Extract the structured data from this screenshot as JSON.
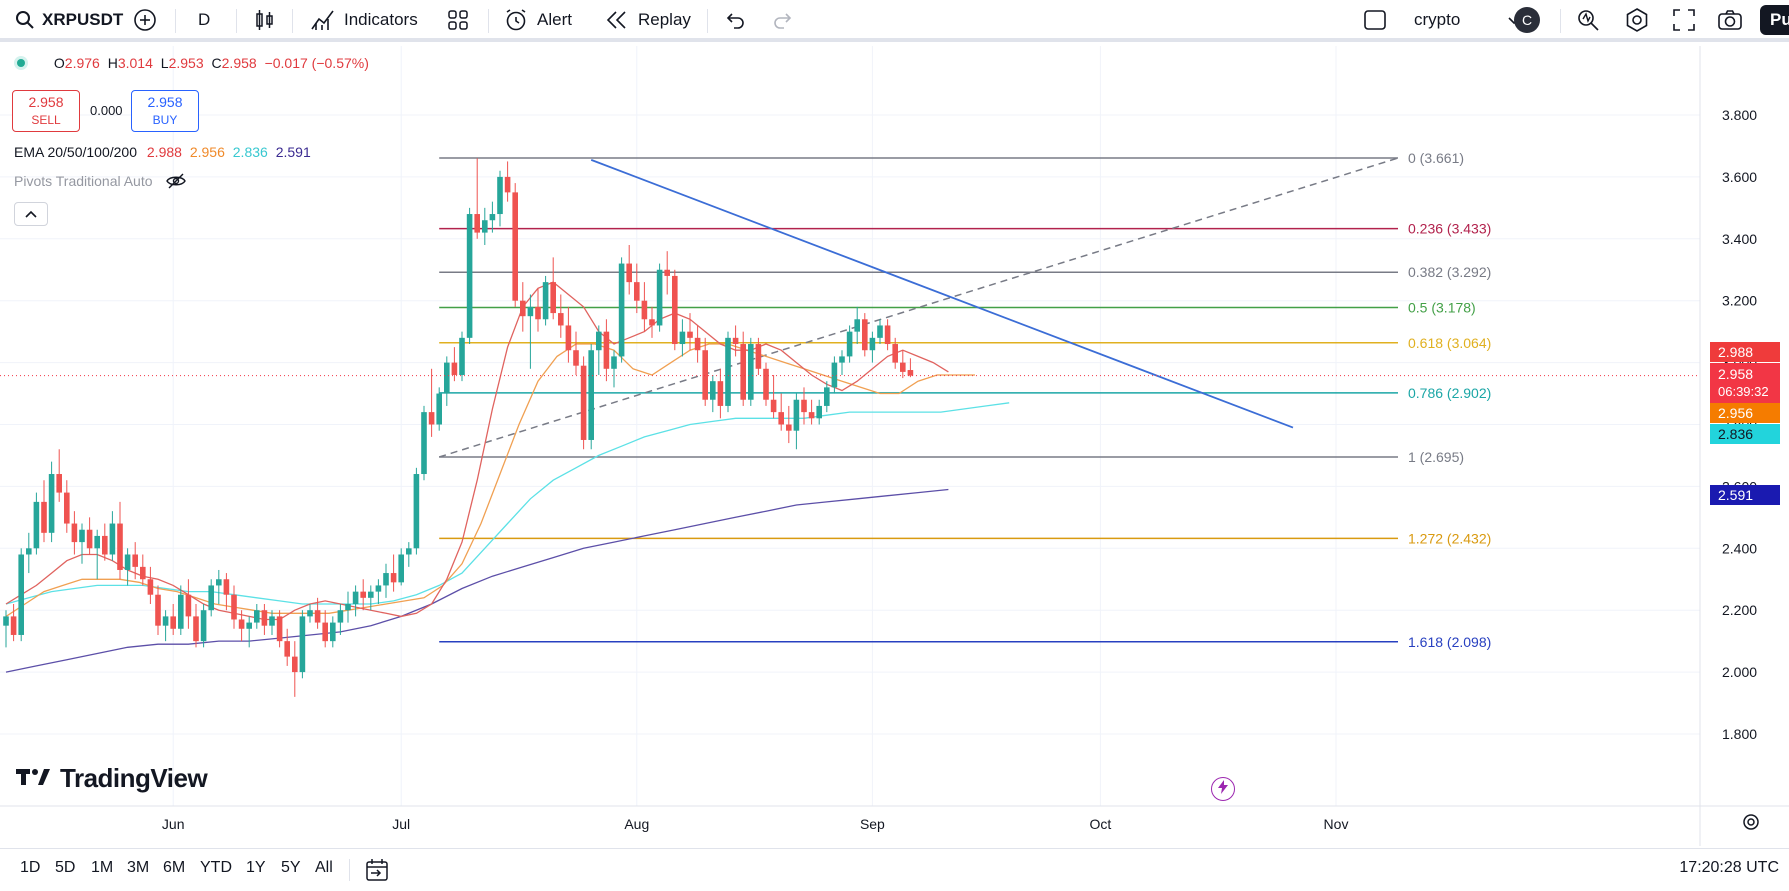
{
  "toolbar": {
    "symbol": "XRPUSDT",
    "interval": "D",
    "indicators_label": "Indicators",
    "alert_label": "Alert",
    "replay_label": "Replay",
    "layout_name": "crypto",
    "avatar_letter": "C",
    "publish_label": "Pu"
  },
  "legend": {
    "o_label": "O",
    "o_value": "2.976",
    "h_label": "H",
    "h_value": "3.014",
    "l_label": "L",
    "l_value": "2.953",
    "c_label": "C",
    "c_value": "2.958",
    "change": "−0.017 (−0.57%)",
    "sell_price": "2.958",
    "sell_label": "SELL",
    "spread": "0.000",
    "buy_price": "2.958",
    "buy_label": "BUY",
    "ema_name": "EMA 20/50/100/200",
    "ema20": "2.988",
    "ema50": "2.956",
    "ema100": "2.836",
    "ema200": "2.591",
    "pivots_label": "Pivots Traditional Auto"
  },
  "colors": {
    "up": "#26a69a",
    "down": "#ef5350",
    "ema20": "#e0635f",
    "ema50": "#f0a052",
    "ema100": "#5ce1e6",
    "ema200": "#5c4fa8",
    "trendline": "#3b6dd6"
  },
  "price_axis": {
    "ticks": [
      "3.800",
      "3.600",
      "3.400",
      "3.200",
      "3.000",
      "2.800",
      "2.600",
      "2.400",
      "2.200",
      "2.000",
      "1.800"
    ],
    "values": [
      3.8,
      3.6,
      3.4,
      3.2,
      3.0,
      2.8,
      2.6,
      2.4,
      2.2,
      2.0,
      1.8
    ]
  },
  "time_axis": {
    "labels": [
      "Jun",
      "Jul",
      "Aug",
      "Sep",
      "Oct",
      "Nov"
    ],
    "day_index": [
      22,
      52,
      83,
      114,
      144,
      175
    ]
  },
  "price_labels": {
    "ema20": "2.988",
    "last": "2.958",
    "countdown": "06:39:32",
    "ema50": "2.956",
    "ema100": "2.836",
    "ema200": "2.591"
  },
  "fibonacci": {
    "levels": [
      {
        "label": "0 (3.661)",
        "price": 3.661,
        "color": "#787b86"
      },
      {
        "label": "0.236 (3.433)",
        "price": 3.433,
        "color": "#b2224d"
      },
      {
        "label": "0.382 (3.292)",
        "price": 3.292,
        "color": "#787b86"
      },
      {
        "label": "0.5 (3.178)",
        "price": 3.178,
        "color": "#43a047"
      },
      {
        "label": "0.618 (3.064)",
        "price": 3.064,
        "color": "#e0b020"
      },
      {
        "label": "0.786 (2.902)",
        "price": 2.902,
        "color": "#1ba6a6"
      },
      {
        "label": "1 (2.695)",
        "price": 2.695,
        "color": "#787b86"
      },
      {
        "label": "1.272 (2.432)",
        "price": 2.432,
        "color": "#d99a10"
      },
      {
        "label": "1.618 (2.098)",
        "price": 2.098,
        "color": "#2840c0"
      }
    ]
  },
  "chart_data": {
    "type": "candlestick",
    "symbol": "XRPUSDT",
    "interval": "D",
    "ylim": [
      1.8,
      3.8
    ],
    "candles": [
      [
        2.15,
        2.2,
        2.08,
        2.18
      ],
      [
        2.18,
        2.22,
        2.1,
        2.12
      ],
      [
        2.12,
        2.4,
        2.1,
        2.38
      ],
      [
        2.38,
        2.45,
        2.32,
        2.4
      ],
      [
        2.4,
        2.58,
        2.38,
        2.55
      ],
      [
        2.55,
        2.62,
        2.42,
        2.45
      ],
      [
        2.45,
        2.68,
        2.42,
        2.64
      ],
      [
        2.64,
        2.72,
        2.55,
        2.58
      ],
      [
        2.58,
        2.62,
        2.45,
        2.48
      ],
      [
        2.48,
        2.52,
        2.38,
        2.42
      ],
      [
        2.42,
        2.48,
        2.35,
        2.46
      ],
      [
        2.46,
        2.5,
        2.38,
        2.4
      ],
      [
        2.4,
        2.46,
        2.3,
        2.44
      ],
      [
        2.44,
        2.48,
        2.36,
        2.38
      ],
      [
        2.38,
        2.52,
        2.36,
        2.48
      ],
      [
        2.48,
        2.55,
        2.3,
        2.33
      ],
      [
        2.33,
        2.4,
        2.28,
        2.38
      ],
      [
        2.38,
        2.42,
        2.3,
        2.34
      ],
      [
        2.34,
        2.38,
        2.28,
        2.3
      ],
      [
        2.3,
        2.34,
        2.22,
        2.25
      ],
      [
        2.25,
        2.28,
        2.12,
        2.15
      ],
      [
        2.15,
        2.2,
        2.1,
        2.18
      ],
      [
        2.18,
        2.22,
        2.12,
        2.14
      ],
      [
        2.14,
        2.28,
        2.12,
        2.25
      ],
      [
        2.25,
        2.3,
        2.14,
        2.18
      ],
      [
        2.18,
        2.22,
        2.08,
        2.1
      ],
      [
        2.1,
        2.22,
        2.08,
        2.2
      ],
      [
        2.2,
        2.3,
        2.18,
        2.28
      ],
      [
        2.28,
        2.33,
        2.22,
        2.3
      ],
      [
        2.3,
        2.32,
        2.2,
        2.25
      ],
      [
        2.25,
        2.28,
        2.14,
        2.17
      ],
      [
        2.17,
        2.2,
        2.1,
        2.14
      ],
      [
        2.14,
        2.18,
        2.08,
        2.16
      ],
      [
        2.16,
        2.22,
        2.14,
        2.2
      ],
      [
        2.2,
        2.22,
        2.12,
        2.15
      ],
      [
        2.15,
        2.2,
        2.12,
        2.18
      ],
      [
        2.18,
        2.2,
        2.08,
        2.1
      ],
      [
        2.1,
        2.14,
        2.02,
        2.05
      ],
      [
        2.05,
        2.1,
        1.92,
        2.0
      ],
      [
        2.0,
        2.2,
        1.98,
        2.18
      ],
      [
        2.18,
        2.22,
        2.16,
        2.2
      ],
      [
        2.2,
        2.24,
        2.14,
        2.16
      ],
      [
        2.16,
        2.2,
        2.08,
        2.1
      ],
      [
        2.1,
        2.18,
        2.08,
        2.16
      ],
      [
        2.16,
        2.22,
        2.12,
        2.2
      ],
      [
        2.2,
        2.26,
        2.16,
        2.22
      ],
      [
        2.22,
        2.28,
        2.18,
        2.26
      ],
      [
        2.26,
        2.3,
        2.2,
        2.24
      ],
      [
        2.24,
        2.28,
        2.2,
        2.26
      ],
      [
        2.26,
        2.3,
        2.22,
        2.28
      ],
      [
        2.28,
        2.35,
        2.24,
        2.32
      ],
      [
        2.32,
        2.38,
        2.26,
        2.29
      ],
      [
        2.29,
        2.4,
        2.28,
        2.38
      ],
      [
        2.38,
        2.42,
        2.34,
        2.4
      ],
      [
        2.4,
        2.66,
        2.38,
        2.64
      ],
      [
        2.64,
        2.86,
        2.62,
        2.84
      ],
      [
        2.84,
        2.98,
        2.76,
        2.8
      ],
      [
        2.8,
        2.92,
        2.78,
        2.9
      ],
      [
        2.9,
        3.02,
        2.86,
        3.0
      ],
      [
        3.0,
        3.05,
        2.94,
        2.96
      ],
      [
        2.96,
        3.1,
        2.94,
        3.08
      ],
      [
        3.08,
        3.5,
        3.06,
        3.48
      ],
      [
        3.48,
        3.66,
        3.4,
        3.42
      ],
      [
        3.42,
        3.5,
        3.38,
        3.46
      ],
      [
        3.46,
        3.52,
        3.42,
        3.48
      ],
      [
        3.48,
        3.62,
        3.44,
        3.6
      ],
      [
        3.6,
        3.65,
        3.52,
        3.55
      ],
      [
        3.55,
        3.58,
        3.18,
        3.2
      ],
      [
        3.2,
        3.26,
        3.1,
        3.15
      ],
      [
        3.15,
        3.22,
        2.98,
        3.18
      ],
      [
        3.18,
        3.24,
        3.1,
        3.14
      ],
      [
        3.14,
        3.28,
        3.12,
        3.26
      ],
      [
        3.26,
        3.34,
        3.14,
        3.16
      ],
      [
        3.16,
        3.22,
        3.08,
        3.12
      ],
      [
        3.12,
        3.18,
        3.0,
        3.04
      ],
      [
        3.04,
        3.1,
        2.96,
        2.99
      ],
      [
        2.99,
        3.02,
        2.72,
        2.75
      ],
      [
        2.75,
        3.06,
        2.72,
        3.04
      ],
      [
        3.04,
        3.12,
        2.96,
        3.1
      ],
      [
        3.1,
        3.14,
        2.94,
        2.98
      ],
      [
        2.98,
        3.04,
        2.92,
        3.02
      ],
      [
        3.02,
        3.34,
        3.0,
        3.32
      ],
      [
        3.32,
        3.38,
        3.22,
        3.26
      ],
      [
        3.26,
        3.32,
        3.16,
        3.2
      ],
      [
        3.2,
        3.26,
        3.1,
        3.14
      ],
      [
        3.14,
        3.18,
        3.08,
        3.12
      ],
      [
        3.12,
        3.32,
        3.1,
        3.3
      ],
      [
        3.3,
        3.36,
        3.22,
        3.28
      ],
      [
        3.28,
        3.3,
        3.04,
        3.06
      ],
      [
        3.06,
        3.14,
        3.02,
        3.1
      ],
      [
        3.1,
        3.16,
        3.04,
        3.08
      ],
      [
        3.08,
        3.12,
        3.0,
        3.04
      ],
      [
        3.04,
        3.08,
        2.86,
        2.88
      ],
      [
        2.88,
        2.96,
        2.84,
        2.94
      ],
      [
        2.94,
        2.98,
        2.82,
        2.86
      ],
      [
        2.86,
        3.1,
        2.84,
        3.08
      ],
      [
        3.08,
        3.12,
        3.02,
        3.06
      ],
      [
        3.06,
        3.1,
        2.86,
        2.88
      ],
      [
        2.88,
        3.08,
        2.86,
        3.06
      ],
      [
        3.06,
        3.08,
        2.96,
        2.98
      ],
      [
        2.98,
        3.0,
        2.86,
        2.88
      ],
      [
        2.88,
        2.96,
        2.82,
        2.84
      ],
      [
        2.84,
        2.9,
        2.78,
        2.8
      ],
      [
        2.8,
        2.86,
        2.74,
        2.78
      ],
      [
        2.78,
        2.9,
        2.72,
        2.88
      ],
      [
        2.88,
        2.92,
        2.8,
        2.84
      ],
      [
        2.84,
        2.88,
        2.8,
        2.82
      ],
      [
        2.82,
        2.88,
        2.8,
        2.86
      ],
      [
        2.86,
        2.94,
        2.84,
        2.92
      ],
      [
        2.92,
        3.02,
        2.9,
        3.0
      ],
      [
        3.0,
        3.04,
        2.96,
        3.02
      ],
      [
        3.02,
        3.12,
        3.0,
        3.1
      ],
      [
        3.1,
        3.18,
        3.06,
        3.14
      ],
      [
        3.14,
        3.16,
        3.02,
        3.04
      ],
      [
        3.04,
        3.1,
        3.0,
        3.08
      ],
      [
        3.08,
        3.14,
        3.06,
        3.12
      ],
      [
        3.12,
        3.14,
        3.04,
        3.06
      ],
      [
        3.06,
        3.08,
        2.98,
        3.0
      ],
      [
        3.0,
        3.04,
        2.95,
        2.97
      ],
      [
        2.976,
        3.014,
        2.953,
        2.958
      ]
    ],
    "ema20": [
      2.22,
      2.25,
      2.28,
      2.32,
      2.36,
      2.38,
      2.38,
      2.36,
      2.33,
      2.31,
      2.3,
      2.28,
      2.25,
      2.22,
      2.2,
      2.19,
      2.18,
      2.17,
      2.17,
      2.2,
      2.22,
      2.23,
      2.22,
      2.21,
      2.2,
      2.19,
      2.18,
      2.19,
      2.22,
      2.3,
      2.42,
      2.62,
      2.85,
      3.05,
      3.18,
      3.24,
      3.26,
      3.22,
      3.18,
      3.1,
      3.06,
      3.08,
      3.1,
      3.14,
      3.16,
      3.14,
      3.1,
      3.06,
      3.04,
      3.04,
      3.06,
      3.04,
      3.0,
      2.96,
      2.93,
      2.91,
      2.94,
      2.98,
      3.02,
      3.04,
      3.02,
      3.0,
      2.97
    ],
    "ema50": [
      2.18,
      2.22,
      2.26,
      2.28,
      2.3,
      2.3,
      2.3,
      2.29,
      2.27,
      2.26,
      2.24,
      2.22,
      2.21,
      2.2,
      2.19,
      2.19,
      2.19,
      2.19,
      2.2,
      2.21,
      2.22,
      2.23,
      2.24,
      2.28,
      2.35,
      2.48,
      2.64,
      2.8,
      2.94,
      3.02,
      3.06,
      3.06,
      3.04,
      2.98,
      2.96,
      3.0,
      3.04,
      3.06,
      3.06,
      3.04,
      3.02,
      3.0,
      2.98,
      2.96,
      2.94,
      2.92,
      2.9,
      2.9,
      2.94,
      2.96,
      2.96,
      2.96
    ],
    "ema100": [
      2.22,
      2.24,
      2.26,
      2.27,
      2.28,
      2.28,
      2.28,
      2.27,
      2.26,
      2.26,
      2.25,
      2.24,
      2.23,
      2.22,
      2.22,
      2.22,
      2.22,
      2.23,
      2.25,
      2.28,
      2.32,
      2.4,
      2.48,
      2.56,
      2.62,
      2.66,
      2.7,
      2.73,
      2.76,
      2.78,
      2.8,
      2.81,
      2.82,
      2.82,
      2.82,
      2.82,
      2.83,
      2.84,
      2.84,
      2.84,
      2.84,
      2.84,
      2.85,
      2.86,
      2.87
    ],
    "ema200": [
      2.0,
      2.02,
      2.04,
      2.06,
      2.08,
      2.09,
      2.09,
      2.1,
      2.1,
      2.11,
      2.12,
      2.13,
      2.15,
      2.18,
      2.22,
      2.27,
      2.31,
      2.34,
      2.37,
      2.4,
      2.42,
      2.44,
      2.46,
      2.48,
      2.5,
      2.52,
      2.54,
      2.55,
      2.56,
      2.57,
      2.58,
      2.59
    ]
  }
}
